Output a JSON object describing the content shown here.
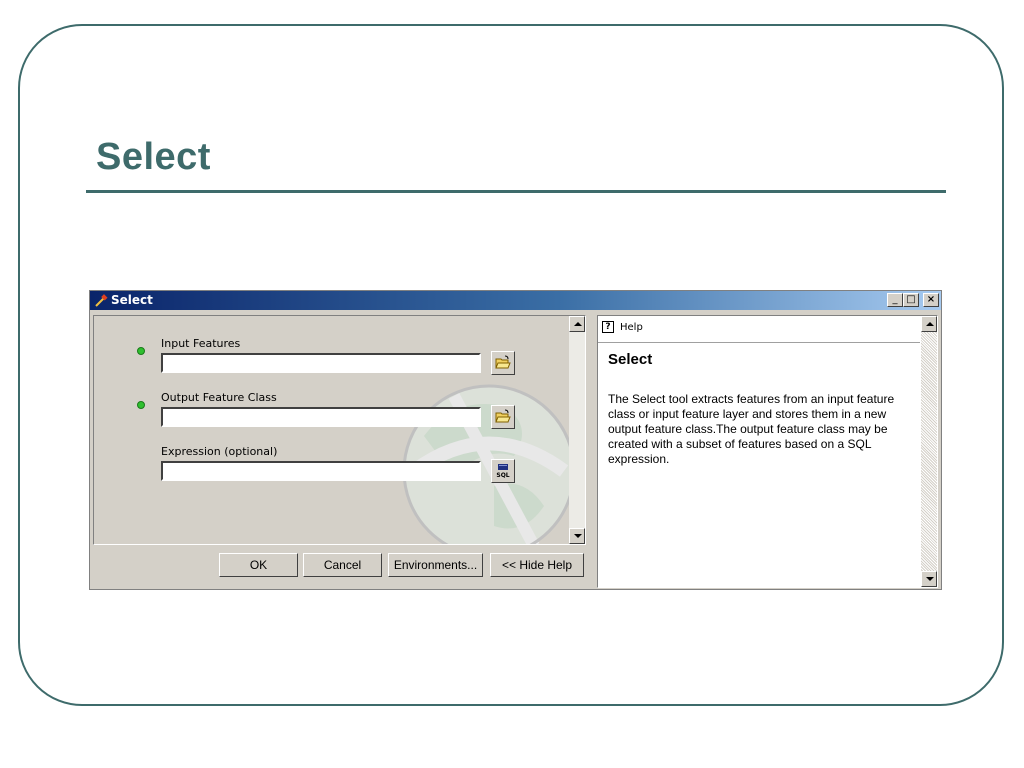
{
  "slide": {
    "title": "Select"
  },
  "dialog": {
    "window_title": "Select",
    "controls": {
      "minimize": "_",
      "maximize": "□",
      "close": "×"
    },
    "fields": [
      {
        "label": "Input Features",
        "value": "",
        "required": true,
        "button_icon": "folder-open-icon"
      },
      {
        "label": "Output Feature Class",
        "value": "",
        "required": true,
        "button_icon": "folder-open-icon"
      },
      {
        "label": "Expression (optional)",
        "value": "",
        "required": false,
        "button_icon": "sql-icon"
      }
    ],
    "sql_icon_text": "SQL",
    "buttons": {
      "ok": "OK",
      "cancel": "Cancel",
      "environments": "Environments...",
      "hide_help": "<< Hide Help"
    }
  },
  "help": {
    "tab_label": "Help",
    "tab_icon_glyph": "?",
    "heading": "Select",
    "body": "The Select tool extracts features from an input feature class or input feature layer and stores them in a new output feature class.The output feature class may be created with a subset of features based on a SQL expression."
  },
  "colors": {
    "accent": "#3e6b6b",
    "titlebar_start": "#0a246a",
    "titlebar_end": "#a6caf0",
    "required_dot": "#2fbf2f",
    "dialog_face": "#d4d0c8"
  }
}
